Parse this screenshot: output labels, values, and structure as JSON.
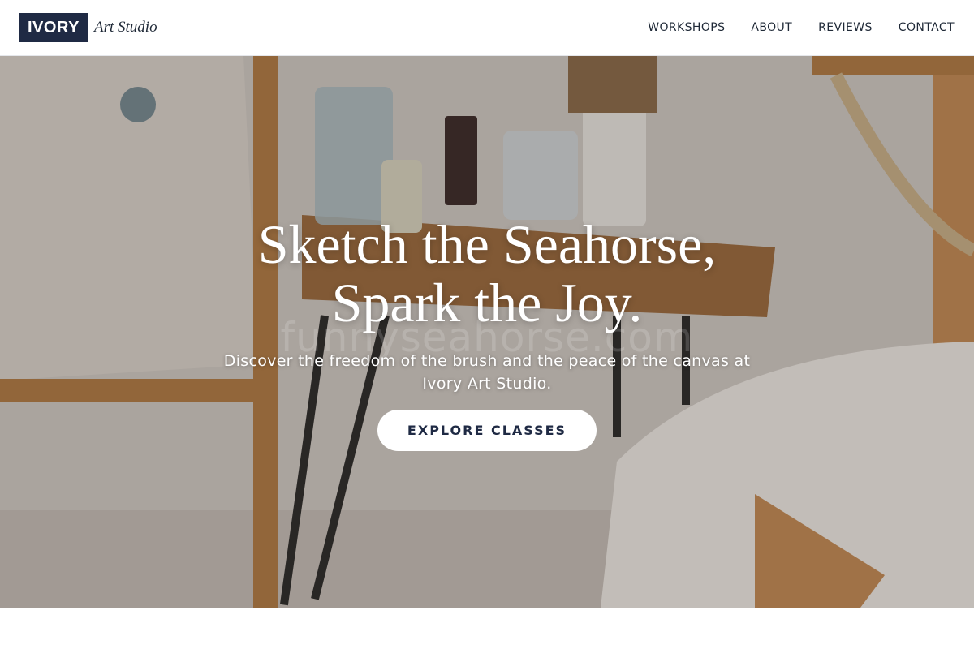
{
  "header": {
    "brand_box": "IVORY",
    "brand_sub": "Art Studio",
    "nav": [
      {
        "label": "WORKSHOPS"
      },
      {
        "label": "ABOUT"
      },
      {
        "label": "REVIEWS"
      },
      {
        "label": "CONTACT"
      }
    ]
  },
  "hero": {
    "headline_line1": "Sketch the Seahorse,",
    "headline_line2": "Spark the Joy.",
    "subtitle": "Discover the freedom of the brush and the peace of the canvas at Ivory Art Studio.",
    "cta_label": "EXPLORE CLASSES",
    "watermark": "funnyseahorse.com"
  },
  "colors": {
    "brand_navy": "#1f2a44",
    "text_dark": "#1f2937",
    "cta_bg": "#ffffff",
    "hero_tint": "#c9c3bf"
  },
  "icons": []
}
